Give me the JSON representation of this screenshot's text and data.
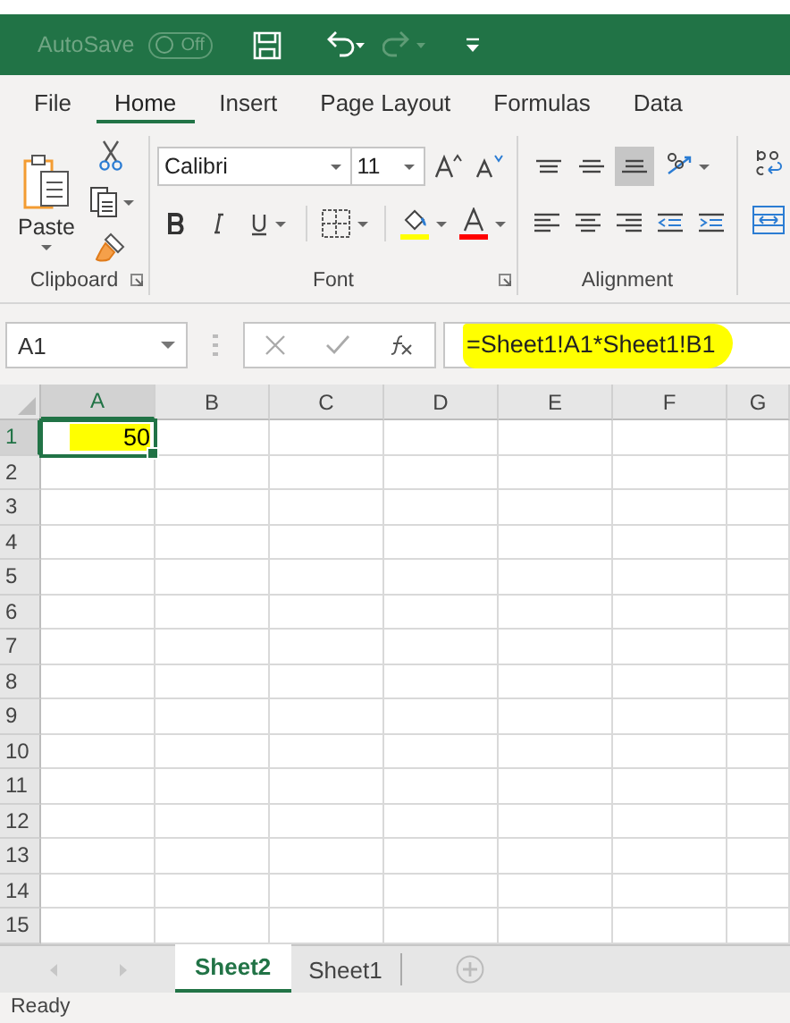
{
  "title_bar": {
    "autosave_label": "AutoSave",
    "autosave_toggle": {
      "label": "Off",
      "on": false
    }
  },
  "ribbon_tabs": [
    {
      "label": "File",
      "selected": false
    },
    {
      "label": "Home",
      "selected": true
    },
    {
      "label": "Insert",
      "selected": false
    },
    {
      "label": "Page Layout",
      "selected": false
    },
    {
      "label": "Formulas",
      "selected": false
    },
    {
      "label": "Data",
      "selected": false
    }
  ],
  "ribbon": {
    "clipboard": {
      "paste_label": "Paste",
      "group_label": "Clipboard"
    },
    "font": {
      "font_name": "Calibri",
      "font_size": "11",
      "group_label": "Font"
    },
    "alignment": {
      "group_label": "Alignment",
      "top_buttons": [
        {
          "kind": "top",
          "selected": false
        },
        {
          "kind": "middle",
          "selected": false
        },
        {
          "kind": "bottom",
          "selected": true
        },
        {
          "kind": "orientation",
          "selected": false
        }
      ]
    }
  },
  "formula_bar": {
    "name_box": "A1",
    "formula": "=Sheet1!A1*Sheet1!B1",
    "highlighted": true
  },
  "grid": {
    "columns": [
      "A",
      "B",
      "C",
      "D",
      "E",
      "F",
      "G"
    ],
    "rows": [
      {
        "label": "1",
        "cells": [
          {
            "value": "50",
            "selected": true,
            "highlighted": true
          }
        ]
      },
      {
        "label": "2"
      },
      {
        "label": "3"
      },
      {
        "label": "4"
      },
      {
        "label": "5"
      },
      {
        "label": "6"
      },
      {
        "label": "7"
      },
      {
        "label": "8"
      },
      {
        "label": "9"
      },
      {
        "label": "10"
      },
      {
        "label": "11"
      },
      {
        "label": "12"
      },
      {
        "label": "13"
      },
      {
        "label": "14"
      },
      {
        "label": "15"
      }
    ]
  },
  "sheet_tabs": [
    {
      "label": "Sheet2",
      "selected": true
    },
    {
      "label": "Sheet1",
      "selected": false
    }
  ],
  "status_bar": {
    "text": "Ready"
  }
}
